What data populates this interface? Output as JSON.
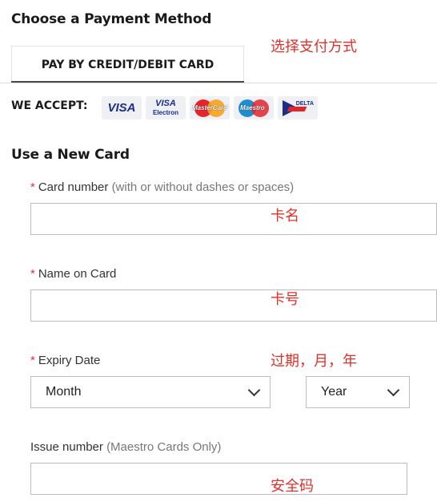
{
  "header": {
    "title": "Choose a Payment Method"
  },
  "annotations": {
    "payment_method": "选择支付方式",
    "card_number": "卡名",
    "name_on_card": "卡号",
    "expiry": "过期，月，年",
    "issue_number": "安全码"
  },
  "tabs": [
    {
      "label": "PAY BY CREDIT/DEBIT CARD",
      "active": true
    }
  ],
  "accept": {
    "label": "WE ACCEPT:",
    "cards": [
      {
        "name": "visa",
        "text": "VISA"
      },
      {
        "name": "visa-electron",
        "text_top": "VISA",
        "text_bottom": "Electron"
      },
      {
        "name": "mastercard",
        "text": "MasterCard"
      },
      {
        "name": "maestro",
        "text": "Maestro"
      },
      {
        "name": "delta",
        "text": "DELTA"
      }
    ]
  },
  "form": {
    "title": "Use a New Card",
    "required_marker": "*",
    "card_number": {
      "label": "Card number",
      "hint": "(with or without dashes or spaces)",
      "value": ""
    },
    "name_on_card": {
      "label": "Name on Card",
      "value": ""
    },
    "expiry": {
      "label": "Expiry Date",
      "month": "Month",
      "year": "Year"
    },
    "issue_number": {
      "label": "Issue number",
      "hint": "(Maestro Cards Only)",
      "value": ""
    }
  },
  "colors": {
    "accent_red": "#e0312b",
    "tab_underline": "#4a4a4a",
    "input_border": "#bdbdbd"
  }
}
